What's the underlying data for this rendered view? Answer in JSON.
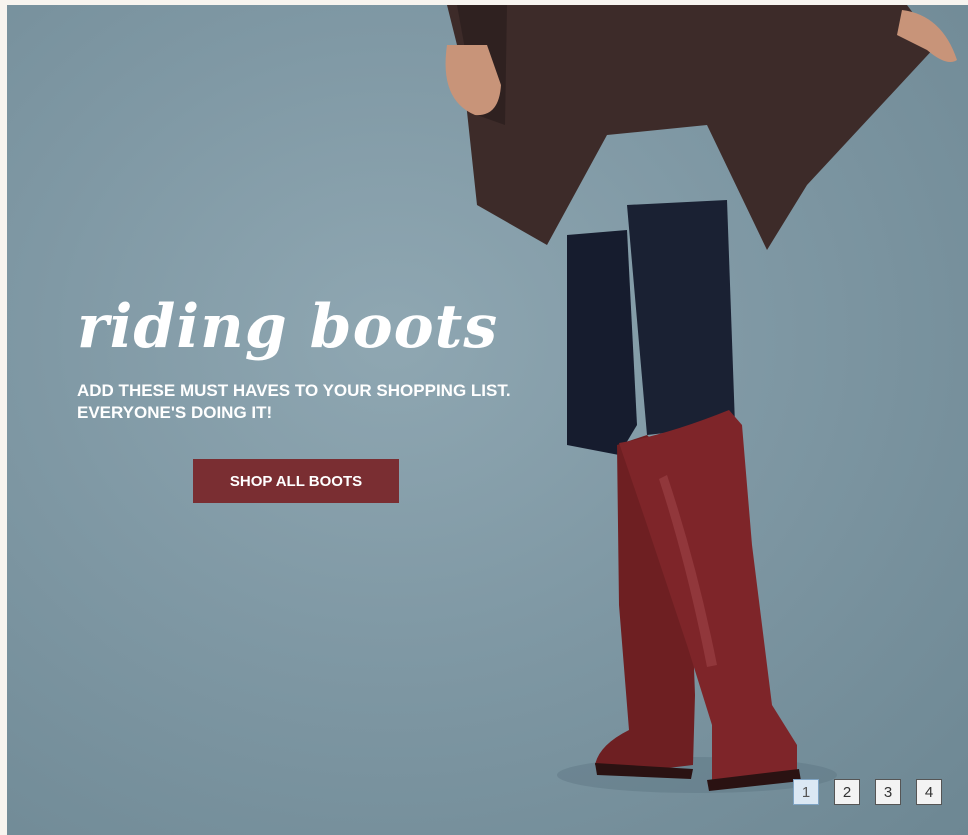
{
  "hero": {
    "headline": "riding boots",
    "subhead": "ADD THESE MUST HAVES TO YOUR SHOPPING LIST. EVERYONE'S DOING IT!",
    "cta_label": "SHOP ALL BOOTS",
    "background_color": "#7f98a4",
    "cta_color": "#7a2e32",
    "photo_subject": "model-legs-wearing-red-riding-boots"
  },
  "pagination": {
    "pages": [
      "1",
      "2",
      "3",
      "4"
    ],
    "active_page": "1"
  }
}
